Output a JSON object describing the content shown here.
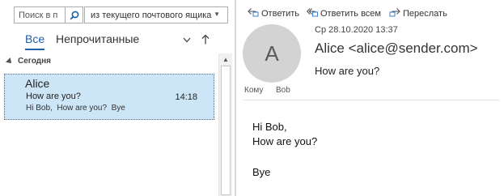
{
  "search": {
    "placeholder": "Поиск в п",
    "scope": "из текущего почтового ящика"
  },
  "tabs": [
    {
      "label": "Все",
      "active": true
    },
    {
      "label": "Непрочитанные",
      "active": false
    }
  ],
  "group": {
    "label": "Сегодня"
  },
  "message_list": [
    {
      "from": "Alice",
      "subject": "How are you?",
      "time": "14:18",
      "preview": "Hi Bob,  How are you?  Bye",
      "selected": true
    }
  ],
  "toolbar": {
    "reply": "Ответить",
    "reply_all": "Ответить всем",
    "forward": "Переслать"
  },
  "reading": {
    "avatar_initial": "A",
    "date": "Ср 28.10.2020 13:37",
    "sender": "Alice <alice@sender.com>",
    "subject": "How are you?",
    "to_label": "Кому",
    "to_value": "Bob",
    "body": [
      "Hi Bob,",
      "How are you?",
      "Bye"
    ]
  },
  "colors": {
    "accent": "#1f5ea8",
    "selected_item": "#cde6f7",
    "avatar_bg": "#d3d3d3"
  }
}
